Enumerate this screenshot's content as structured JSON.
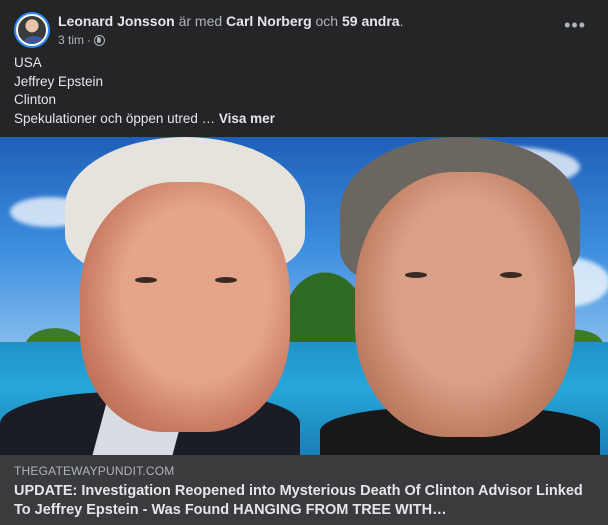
{
  "post": {
    "author": "Leonard Jonsson",
    "with_text": "är med",
    "tagged": "Carl Norberg",
    "and_text": "och",
    "others": "59 andra",
    "period": ".",
    "time": "3 tim",
    "dot": "·",
    "privacy_icon": "globe-icon",
    "more_icon": "more-horizontal-icon",
    "more_glyph": "•••"
  },
  "body_text": {
    "lines": [
      "USA",
      "Jeffrey Epstein",
      "Clinton"
    ],
    "truncated": "Spekulationer och öppen utred … ",
    "see_more": "Visa mer"
  },
  "link": {
    "domain": "THEGATEWAYPUNDIT.COM",
    "headline": "UPDATE: Investigation Reopened into Mysterious Death Of Clinton Advisor Linked To Jeffrey Epstein - Was Found HANGING FROM TREE WITH…"
  },
  "colors": {
    "background": "#242526",
    "link_box": "#3a3b3c",
    "text_primary": "#e4e6eb",
    "text_secondary": "#b0b3b8",
    "avatar_ring": "#2d88ff"
  }
}
